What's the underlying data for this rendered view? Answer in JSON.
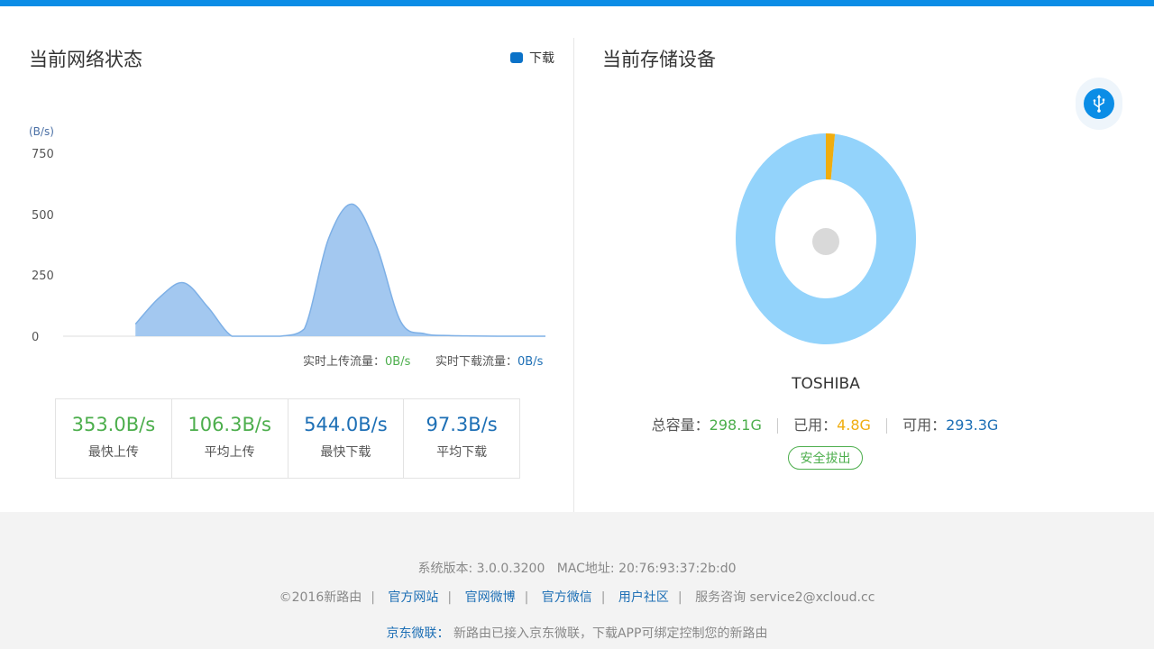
{
  "network": {
    "title": "当前网络状态",
    "legend_label": "下载",
    "unit_label": "(B/s)",
    "realtime_upload_label": "实时上传流量：",
    "realtime_upload_value": "0B/s",
    "realtime_download_label": "实时下载流量：",
    "realtime_download_value": "0B/s",
    "stats": [
      {
        "value": "353.0B/s",
        "label": "最快上传"
      },
      {
        "value": "106.3B/s",
        "label": "平均上传"
      },
      {
        "value": "544.0B/s",
        "label": "最快下载"
      },
      {
        "value": "97.3B/s",
        "label": "平均下载"
      }
    ]
  },
  "chart_data": {
    "type": "area",
    "series": [
      {
        "name": "下载",
        "x": [
          0,
          1,
          2,
          3,
          4,
          5,
          6,
          7,
          8,
          9,
          10,
          11,
          12,
          13,
          14,
          15,
          16,
          17,
          18,
          19,
          20
        ],
        "values": [
          null,
          null,
          null,
          50,
          160,
          220,
          120,
          0,
          0,
          0,
          30,
          400,
          544,
          370,
          60,
          10,
          3,
          1,
          0,
          0,
          0
        ]
      }
    ],
    "y_ticks": [
      "0",
      "250",
      "500",
      "750"
    ],
    "ylim": [
      0,
      750
    ],
    "ylabel": "(B/s)",
    "colors": {
      "fill": "#a3c8f0",
      "stroke": "#7eb0e6"
    }
  },
  "storage": {
    "title": "当前存储设备",
    "device_name": "TOSHIBA",
    "total_label": "总容量：",
    "total_value": "298.1G",
    "used_label": "已用：",
    "used_value": "4.8G",
    "free_label": "可用：",
    "free_value": "293.3G",
    "eject_label": "安全拔出",
    "donut": {
      "used": 4.8,
      "free": 293.3,
      "used_color": "#f0ad0f",
      "free_color": "#93d3fb"
    }
  },
  "footer": {
    "version_label": "系统版本:",
    "version_value": "3.0.0.3200",
    "mac_label": "MAC地址:",
    "mac_value": "20:76:93:37:2b:d0",
    "copyright": "©2016新路由",
    "links": [
      "官方网站",
      "官网微博",
      "官方微信",
      "用户社区"
    ],
    "service": "服务咨询 service2@xcloud.cc",
    "jd_label": "京东微联：",
    "jd_text": "新路由已接入京东微联，下载APP可绑定控制您的新路由"
  }
}
